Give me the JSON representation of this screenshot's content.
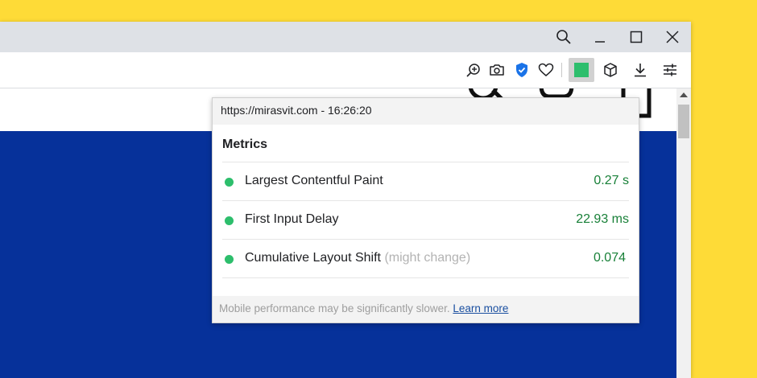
{
  "colors": {
    "background": "#FEDB37",
    "hero": "#06319A",
    "good": "#2DBE6C",
    "good_text": "#188038",
    "link": "#1a4fa0"
  },
  "titlebar": {
    "icons": [
      "search-icon",
      "minimize-icon",
      "maximize-icon",
      "close-icon"
    ]
  },
  "toolbar": {
    "icons": [
      "zoom-in-icon",
      "camera-icon",
      "shield-check-icon",
      "heart-icon",
      "web-vitals-extension-icon",
      "box-icon",
      "download-icon",
      "settings-icon"
    ]
  },
  "popup": {
    "header": "https://mirasvit.com - 16:26:20",
    "title": "Metrics",
    "metrics": [
      {
        "name": "Largest Contentful Paint",
        "note": "",
        "value": "0.27 s",
        "status": "good"
      },
      {
        "name": "First Input Delay",
        "note": "",
        "value": "22.93 ms",
        "status": "good"
      },
      {
        "name": "Cumulative Layout Shift",
        "note": "(might change)",
        "value": "0.074",
        "status": "good"
      }
    ],
    "footer_text": "Mobile performance may be significantly slower.",
    "footer_link": "Learn more"
  }
}
